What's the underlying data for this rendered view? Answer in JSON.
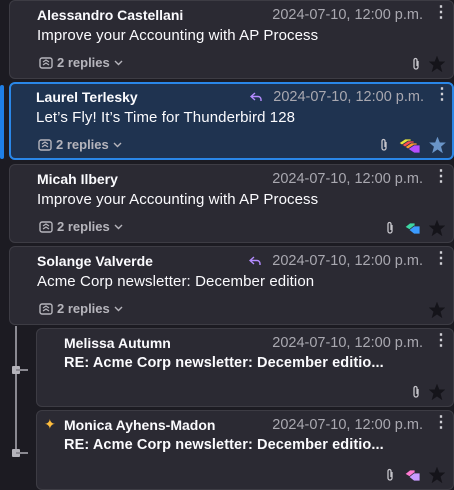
{
  "messages": [
    {
      "sender": "Alessandro Castellani",
      "date": "2024-07-10, 12:00 p.m.",
      "subject": "Improve your Accounting with AP Process",
      "replies": "2 replies"
    },
    {
      "sender": "Laurel Terlesky",
      "date": "2024-07-10, 12:00 p.m.",
      "subject": "Let’s Fly! It’s Time for Thunderbird 128",
      "replies": "2 replies"
    },
    {
      "sender": "Micah Ilbery",
      "date": "2024-07-10, 12:00 p.m.",
      "subject": "Improve your Accounting with AP Process",
      "replies": "2 replies"
    },
    {
      "sender": "Solange Valverde",
      "date": "2024-07-10, 12:00 p.m.",
      "subject": "Acme Corp newsletter: December edition",
      "replies": "2 replies"
    },
    {
      "sender": "Melissa Autumn",
      "date": "2024-07-10, 12:00 p.m.",
      "subject": "RE: Acme Corp newsletter: December editio..."
    },
    {
      "sender": "Monica Ayhens-Madon",
      "date": "2024-07-10, 12:00 p.m.",
      "subject": "RE: Acme Corp newsletter: December editio..."
    }
  ],
  "colors": {
    "background": "#1c1b22",
    "card": "#2b2a33",
    "selected_card": "#1f3350",
    "selected_border": "#2a87e8",
    "reply_arrow": "#b48cff",
    "sparkle": "#ffbd3d"
  },
  "icons": [
    "menu-kebab-icon",
    "replies-icon",
    "chevron-down-icon",
    "attachment-icon",
    "star-icon",
    "tag-icon",
    "replied-arrow-icon",
    "new-sparkle-icon"
  ]
}
